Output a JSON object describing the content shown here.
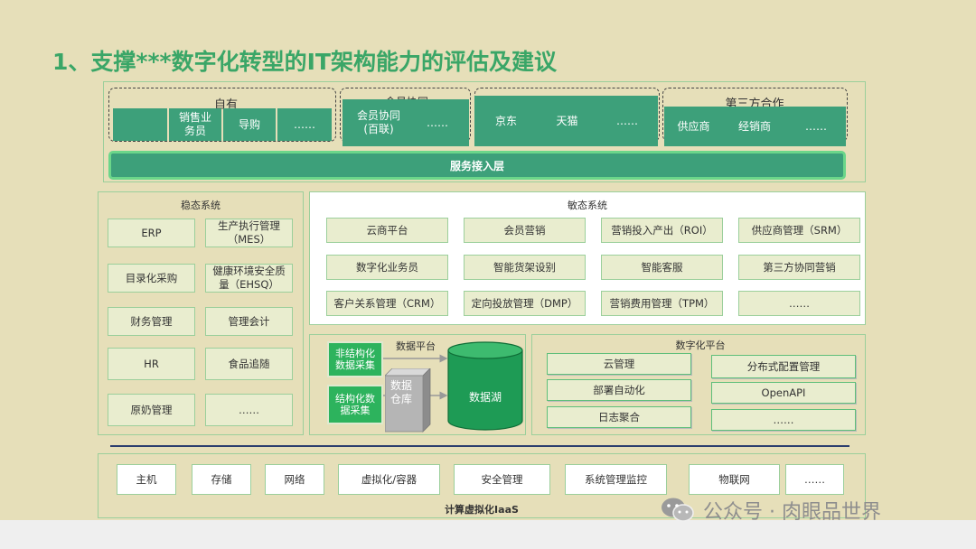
{
  "title": "1、支撑***数字化转型的IT架构能力的评估及建议",
  "channels": {
    "groups": [
      "自有",
      "会员协同",
      "第三方合作"
    ],
    "cells": [
      "销售业务员",
      "导购",
      "……",
      "会员协同(百联)",
      "……",
      "京东",
      "天猫",
      "……",
      "供应商",
      "经销商",
      "……"
    ],
    "service_layer": "服务接入层"
  },
  "stable": {
    "title": "稳态系统",
    "items": [
      "ERP",
      "生产执行管理（MES）",
      "目录化采购",
      "健康环境安全质量（EHSQ）",
      "财务管理",
      "管理会计",
      "HR",
      "食品追随",
      "原奶管理",
      "……"
    ]
  },
  "agile": {
    "title": "敏态系统",
    "items": [
      "云商平台",
      "会员营销",
      "营销投入产出（ROI）",
      "供应商管理（SRM）",
      "数字化业务员",
      "智能货架设别",
      "智能客服",
      "第三方协同营销",
      "客户关系管理（CRM）",
      "定向投放管理（DMP）",
      "营销费用管理（TPM）",
      "……"
    ]
  },
  "data_platform": {
    "title": "数据平台",
    "unstructured": "非结构化数据采集",
    "structured": "结构化数据采集",
    "warehouse": "数据仓库",
    "lake": "数据湖"
  },
  "digital_platform": {
    "title": "数字化平台",
    "left": [
      "云管理",
      "部署自动化",
      "日志聚合"
    ],
    "right": [
      "分布式配置管理",
      "OpenAPI",
      "……"
    ]
  },
  "iaas": {
    "items": [
      "主机",
      "存储",
      "网络",
      "虚拟化/容器",
      "安全管理",
      "系统管理监控",
      "物联网",
      "……"
    ],
    "label": "计算虚拟化IaaS"
  },
  "watermark": "公众号 · 肉眼品世界",
  "colors": {
    "background": "#e6dfb9",
    "accent": "#3aa667",
    "dark_green": "#3da07a",
    "bright_green": "#2db35d"
  }
}
